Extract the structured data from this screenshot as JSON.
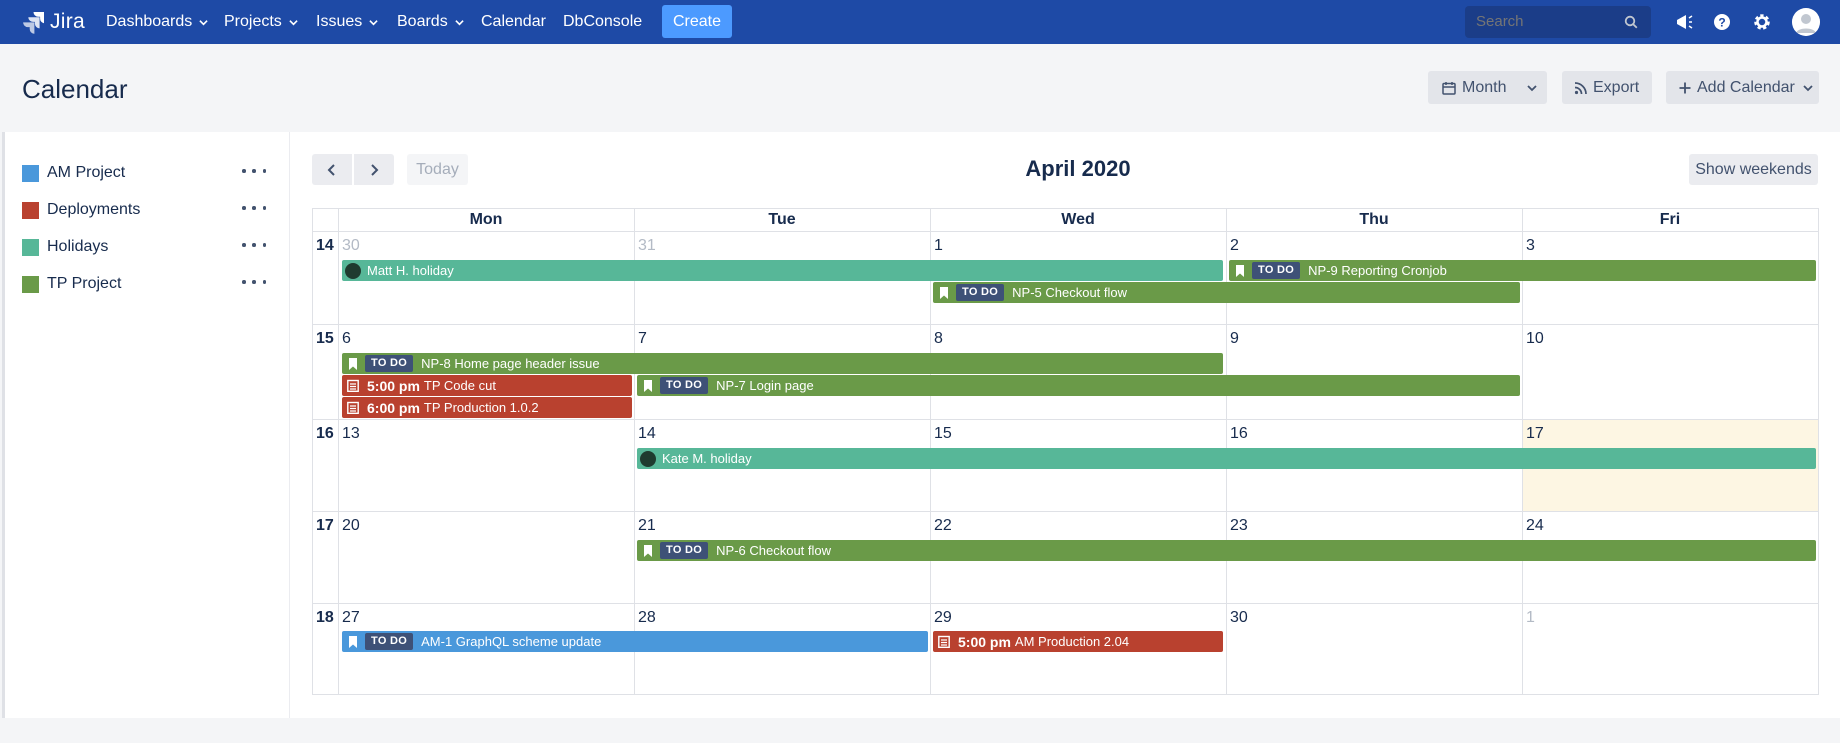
{
  "nav": {
    "logo_text": "Jira",
    "items": [
      {
        "label": "Dashboards",
        "dropdown": true
      },
      {
        "label": "Projects",
        "dropdown": true
      },
      {
        "label": "Issues",
        "dropdown": true
      },
      {
        "label": "Boards",
        "dropdown": true
      },
      {
        "label": "Calendar",
        "dropdown": false
      },
      {
        "label": "DbConsole",
        "dropdown": false
      }
    ],
    "create_label": "Create",
    "search_placeholder": "Search",
    "icons": [
      "notifications-icon",
      "help-icon",
      "settings-icon",
      "avatar"
    ]
  },
  "page": {
    "title": "Calendar",
    "view_label": "Month",
    "export_label": "Export",
    "add_calendar_label": "Add Calendar"
  },
  "sidebar": {
    "calendars": [
      {
        "label": "AM Project",
        "color": "#4a98db"
      },
      {
        "label": "Deployments",
        "color": "#b9412f"
      },
      {
        "label": "Holidays",
        "color": "#57b798"
      },
      {
        "label": "TP Project",
        "color": "#6a9a48"
      }
    ]
  },
  "toolbar": {
    "today_label": "Today",
    "month_title": "April 2020",
    "show_weekends_label": "Show weekends"
  },
  "calendar": {
    "days": [
      "Mon",
      "Tue",
      "Wed",
      "Thu",
      "Fri"
    ],
    "weeks": [
      {
        "week": "14",
        "dates": [
          "30",
          "31",
          "1",
          "2",
          "3"
        ],
        "muted": [
          true,
          true,
          false,
          false,
          false
        ]
      },
      {
        "week": "15",
        "dates": [
          "6",
          "7",
          "8",
          "9",
          "10"
        ],
        "muted": [
          false,
          false,
          false,
          false,
          false
        ]
      },
      {
        "week": "16",
        "dates": [
          "13",
          "14",
          "15",
          "16",
          "17"
        ],
        "muted": [
          false,
          false,
          false,
          false,
          false
        ]
      },
      {
        "week": "17",
        "dates": [
          "20",
          "21",
          "22",
          "23",
          "24"
        ],
        "muted": [
          false,
          false,
          false,
          false,
          false
        ]
      },
      {
        "week": "18",
        "dates": [
          "27",
          "28",
          "29",
          "30",
          "1"
        ],
        "muted": [
          false,
          false,
          false,
          false,
          true
        ]
      }
    ],
    "events": {
      "e1": {
        "title": "Matt H. holiday"
      },
      "e2": {
        "status": "TO DO",
        "title": "NP-9 Reporting Cronjob"
      },
      "e3": {
        "status": "TO DO",
        "title": "NP-5 Checkout flow"
      },
      "e4": {
        "status": "TO DO",
        "title": "NP-8 Home page header issue"
      },
      "e5": {
        "time": "5:00 pm",
        "title": "TP Code cut"
      },
      "e6": {
        "status": "TO DO",
        "title": "NP-7 Login page"
      },
      "e7": {
        "time": "6:00 pm",
        "title": "TP Production 1.0.2"
      },
      "e8": {
        "title": "Kate M. holiday"
      },
      "e9": {
        "status": "TO DO",
        "title": "NP-6 Checkout flow"
      },
      "e10": {
        "status": "TO DO",
        "title": "AM-1 GraphQL scheme update"
      },
      "e11": {
        "time": "5:00 pm",
        "title": "AM Production 2.04"
      }
    }
  }
}
